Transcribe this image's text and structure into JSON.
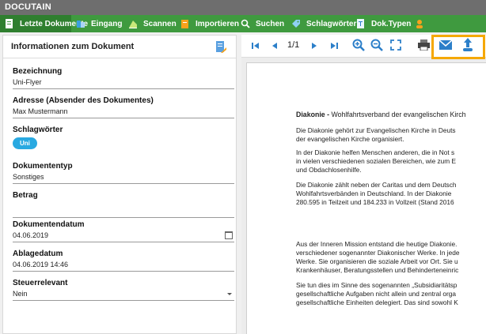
{
  "app": {
    "title": "DOCUTAIN"
  },
  "nav": {
    "items": [
      {
        "label": "Letzte Dokumente",
        "icon": "document-icon"
      },
      {
        "label": "Eingang",
        "icon": "inbox-icon"
      },
      {
        "label": "Scannen",
        "icon": "scanner-icon"
      },
      {
        "label": "Importieren",
        "icon": "import-icon"
      },
      {
        "label": "Suchen",
        "icon": "search-icon"
      },
      {
        "label": "Schlagwörter",
        "icon": "tag-icon"
      },
      {
        "label": "Dok.Typen",
        "icon": "doctype-icon"
      }
    ]
  },
  "info": {
    "title": "Informationen zum Dokument",
    "fields": {
      "bezeichnung": {
        "label": "Bezeichnung",
        "value": "Uni-Flyer"
      },
      "adresse": {
        "label": "Adresse (Absender des Dokumentes)",
        "value": "Max Mustermann"
      },
      "schlagwoerter": {
        "label": "Schlagwörter",
        "chip": "Uni"
      },
      "dokumententyp": {
        "label": "Dokumententyp",
        "value": "Sonstiges"
      },
      "betrag": {
        "label": "Betrag",
        "value": ""
      },
      "dokumentendatum": {
        "label": "Dokumentendatum",
        "value": "04.06.2019"
      },
      "ablagedatum": {
        "label": "Ablagedatum",
        "value": "04.06.2019 14:46"
      },
      "steuerrelevant": {
        "label": "Steuerrelevant",
        "value": "Nein"
      }
    }
  },
  "viewer": {
    "page_indicator": "1/1",
    "colors": {
      "accent": "#2c7fc9",
      "highlight": "#f5a800",
      "nav": "#3f9a3f"
    },
    "document": {
      "heading_bold": "Diakonie -",
      "heading_rest": " Wohlfahrtsverband der evangelischen Kirch",
      "lines": [
        "Die Diakonie gehört zur Evangelischen Kirche in Deuts",
        "der evangelischen Kirche organisiert.",
        "In der Diakonie helfen Menschen anderen, die in Not s",
        "in vielen verschiedenen sozialen Bereichen, wie zum E",
        "und Obdachlosenhilfe.",
        "Die Diakonie zählt neben der Caritas und dem Deutsch",
        "Wohlfahrtsverbänden in Deutschland. In der Diakonie",
        "280.595 in Teilzeit und 184.233 in Vollzeit (Stand 2016",
        "Aus der Inneren Mission entstand die heutige Diakonie.",
        "verschiedener sogenannter Diakonischer Werke. In jede",
        "Werke. Sie organisieren die soziale Arbeit vor Ort. Sie u",
        "Krankenhäuser, Beratungsstellen und Behinderteneinric",
        "Sie tun dies im Sinne des sogenannten „Subsidiaritätsp",
        "gesellschaftliche Aufgaben nicht allein und zentral orga",
        "gesellschaftliche Einheiten delegiert. Das sind sowohl K"
      ]
    }
  }
}
